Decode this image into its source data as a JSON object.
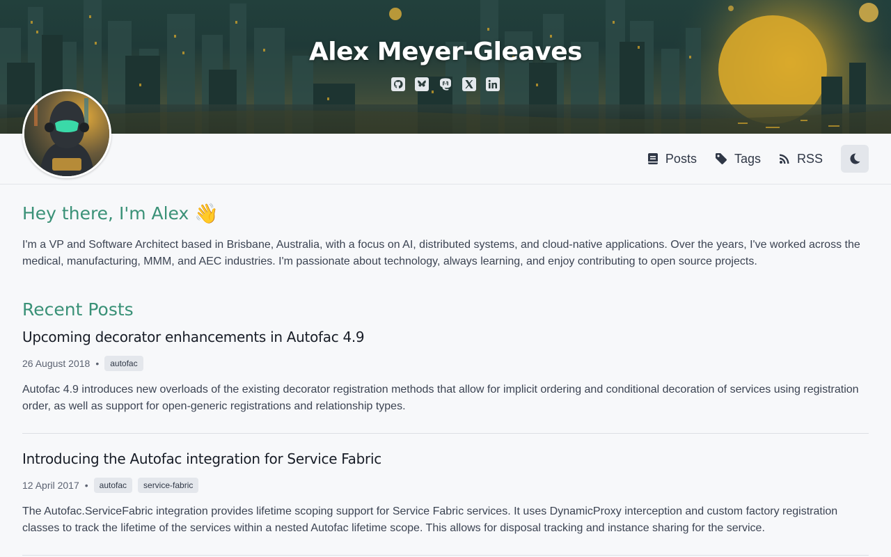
{
  "site": {
    "title": "Alex Meyer-Gleaves",
    "social": [
      {
        "name": "github-icon"
      },
      {
        "name": "bluesky-icon"
      },
      {
        "name": "mastodon-icon"
      },
      {
        "name": "x-icon"
      },
      {
        "name": "linkedin-icon"
      }
    ]
  },
  "nav": {
    "posts": "Posts",
    "tags": "Tags",
    "rss": "RSS",
    "theme_icon": "moon-icon"
  },
  "intro": {
    "heading": "Hey there, I'm Alex",
    "emoji": "👋",
    "text": "I'm a VP and Software Architect based in Brisbane, Australia, with a focus on AI, distributed systems, and cloud-native applications. Over the years, I've worked across the medical, manufacturing, MMM, and AEC industries. I'm passionate about technology, always learning, and enjoy contributing to open source projects."
  },
  "recent": {
    "heading": "Recent Posts",
    "posts": [
      {
        "title": "Upcoming decorator enhancements in Autofac 4.9",
        "date": "26 August 2018",
        "separator": "•",
        "tags": [
          "autofac"
        ],
        "summary": "Autofac 4.9 introduces new overloads of the existing decorator registration methods that allow for implicit ordering and conditional decoration of services using registration order, as well as support for open-generic registrations and relationship types."
      },
      {
        "title": "Introducing the Autofac integration for Service Fabric",
        "date": "12 April 2017",
        "separator": "•",
        "tags": [
          "autofac",
          "service-fabric"
        ],
        "summary": "The Autofac.ServiceFabric integration provides lifetime scoping support for Service Fabric services. It uses DynamicProxy interception and custom factory registration classes to track the lifetime of the services within a nested Autofac lifetime scope. This allows for disposal tracking and instance sharing for the service."
      }
    ]
  },
  "colors": {
    "accent": "#3a9177",
    "text": "#3b4352",
    "title": "#171c26",
    "background": "#f7f8fa"
  }
}
